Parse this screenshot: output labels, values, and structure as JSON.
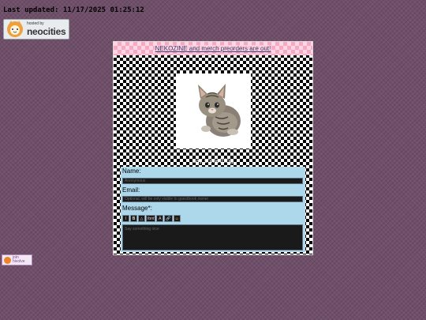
{
  "last_updated": "Last updated: 11/17/2025 01:25:12",
  "neocities_badge": {
    "small": "hosted by",
    "big": "neocities"
  },
  "hivolve_badge": {
    "line1": "join",
    "line2": "hivolve"
  },
  "banner_link": "NEKOZINE and merch preorders are out!",
  "say_something": "say something",
  "form": {
    "name_label": "Name:",
    "name_placeholder": "Anonymous",
    "email_label": "Email:",
    "email_placeholder": "Optional, will be only visible to guestbook owner",
    "message_label": "Message*:",
    "message_placeholder": "Say something nice",
    "toolbar": [
      {
        "label": "I",
        "icon": "italic-icon"
      },
      {
        "label": "B",
        "icon": "bold-icon"
      },
      {
        "label": "△",
        "icon": "spoiler-icon"
      },
      {
        "label": "font",
        "icon": "font-icon"
      },
      {
        "label": "A",
        "icon": "text-color-icon"
      },
      {
        "label": "🔗",
        "icon": "link-icon"
      },
      {
        "label": "☺",
        "icon": "emoji-icon"
      }
    ]
  },
  "colors": {
    "background": "#6f4f69",
    "banner_pink": "#ffd6e2",
    "form_blue": "#add8ec",
    "field_dark": "#1a1a1a"
  }
}
